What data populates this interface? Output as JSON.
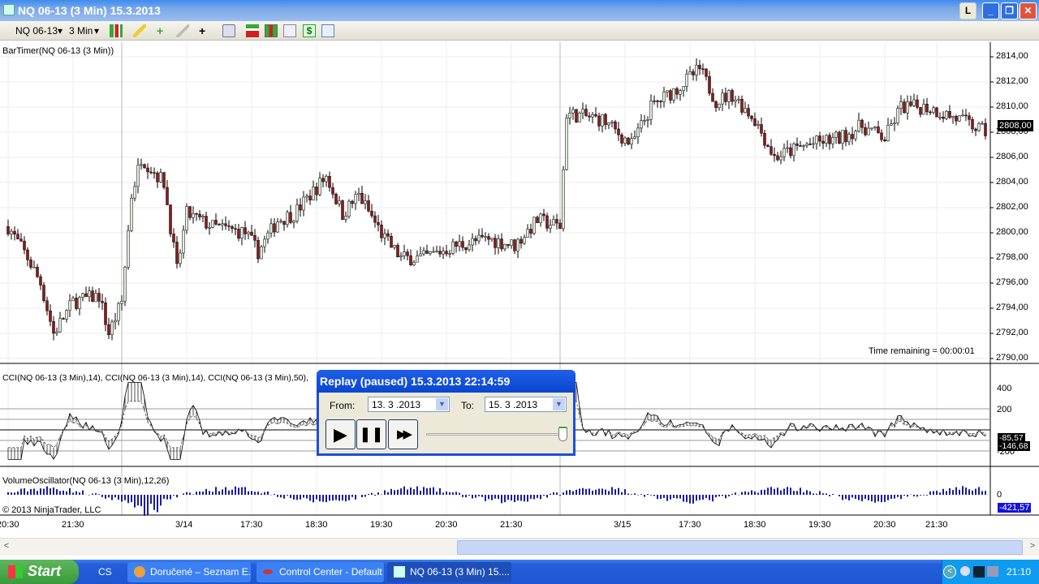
{
  "window": {
    "title": "NQ 06-13 (3 Min)  15.3.2013",
    "layout_button": "L",
    "minimize": "_",
    "restore": "❐",
    "close": "✕"
  },
  "toolbar": {
    "instrument": "NQ 06-13",
    "interval": "3 Min",
    "dropdown": "▾"
  },
  "chart": {
    "indicator_label": "BarTimer(NQ 06-13 (3 Min))",
    "time_remaining": "Time remaining = 00:00:01",
    "price_ticks": [
      "2814,00",
      "2812,00",
      "2810,00",
      "2808,00",
      "2806,00",
      "2804,00",
      "2802,00",
      "2800,00",
      "2798,00",
      "2796,00",
      "2794,00",
      "2792,00",
      "2790,00"
    ],
    "last_price": "2808,00",
    "cci_label": "CCI(NQ 06-13 (3 Min),14), CCI(NQ 06-13 (3 Min),14), CCI(NQ 06-13 (3 Min),50),",
    "cci_ticks": [
      "400",
      "200",
      "0",
      "-200"
    ],
    "cci_value1": "-85,57",
    "cci_value2": "-146,68",
    "vol_label": "VolumeOscillator(NQ 06-13 (3 Min),12,26)",
    "vol_tick": "0",
    "vol_value": "-421,57",
    "copyright": "© 2013 NinjaTrader, LLC",
    "time_labels": [
      {
        "bar": 2,
        "t": "20:30"
      },
      {
        "bar": 22,
        "t": "21:30"
      },
      {
        "bar": 57,
        "t": "3/14"
      },
      {
        "bar": 77,
        "t": "17:30"
      },
      {
        "bar": 97,
        "t": "18:30"
      },
      {
        "bar": 117,
        "t": "19:30"
      },
      {
        "bar": 137,
        "t": "20:30"
      },
      {
        "bar": 157,
        "t": "21:30"
      },
      {
        "bar": 192,
        "t": "3/15"
      },
      {
        "bar": 212,
        "t": "17:30"
      },
      {
        "bar": 232,
        "t": "18:30"
      },
      {
        "bar": 252,
        "t": "19:30"
      },
      {
        "bar": 272,
        "t": "20:30"
      },
      {
        "bar": 288,
        "t": "21:30"
      }
    ]
  },
  "chart_data": {
    "type": "candlestick",
    "y_range": [
      2790,
      2814
    ],
    "session_breaks": [
      37,
      172
    ],
    "price_waypoints": [
      [
        2,
        2800.5
      ],
      [
        8,
        2798
      ],
      [
        12,
        2796
      ],
      [
        16,
        2792
      ],
      [
        22,
        2794.5
      ],
      [
        30,
        2795
      ],
      [
        33,
        2792
      ],
      [
        37,
        2794.5
      ],
      [
        40,
        2803
      ],
      [
        43,
        2806
      ],
      [
        50,
        2804
      ],
      [
        54,
        2797
      ],
      [
        57,
        2801.5
      ],
      [
        65,
        2800.5
      ],
      [
        75,
        2800
      ],
      [
        79,
        2798.5
      ],
      [
        85,
        2801
      ],
      [
        90,
        2801.5
      ],
      [
        95,
        2803
      ],
      [
        100,
        2804.5
      ],
      [
        105,
        2801.5
      ],
      [
        110,
        2803
      ],
      [
        118,
        2799.5
      ],
      [
        123,
        2798
      ],
      [
        130,
        2798
      ],
      [
        140,
        2799
      ],
      [
        150,
        2799.5
      ],
      [
        158,
        2799
      ],
      [
        165,
        2801
      ],
      [
        172,
        2800.5
      ],
      [
        174,
        2809.5
      ],
      [
        185,
        2809
      ],
      [
        194,
        2807
      ],
      [
        200,
        2810
      ],
      [
        208,
        2811.5
      ],
      [
        215,
        2813
      ],
      [
        220,
        2810.5
      ],
      [
        225,
        2811
      ],
      [
        232,
        2809
      ],
      [
        238,
        2806
      ],
      [
        248,
        2807
      ],
      [
        258,
        2807.5
      ],
      [
        265,
        2808.5
      ],
      [
        272,
        2807.5
      ],
      [
        277,
        2810
      ],
      [
        285,
        2810
      ],
      [
        295,
        2809
      ],
      [
        303,
        2808
      ]
    ],
    "cci_range": [
      -300,
      500
    ],
    "vol_zero": 0
  },
  "replay": {
    "title": "Replay (paused) 15.3.2013 22:14:59",
    "from_label": "From:",
    "from_value": "13. 3 .2013",
    "to_label": "To:",
    "to_value": "15. 3 .2013",
    "play": "▶",
    "pause": "❚❚",
    "fast_forward": "▶▶",
    "progress": 1.0
  },
  "scrollbar": {
    "left": "<",
    "right": ">"
  },
  "taskbar": {
    "start": "Start",
    "lang": "CS",
    "tasks": [
      "Doručené – Seznam E...",
      "Control Center - Default",
      "NQ 06-13 (3 Min)  15...."
    ],
    "clock": "21:10"
  }
}
